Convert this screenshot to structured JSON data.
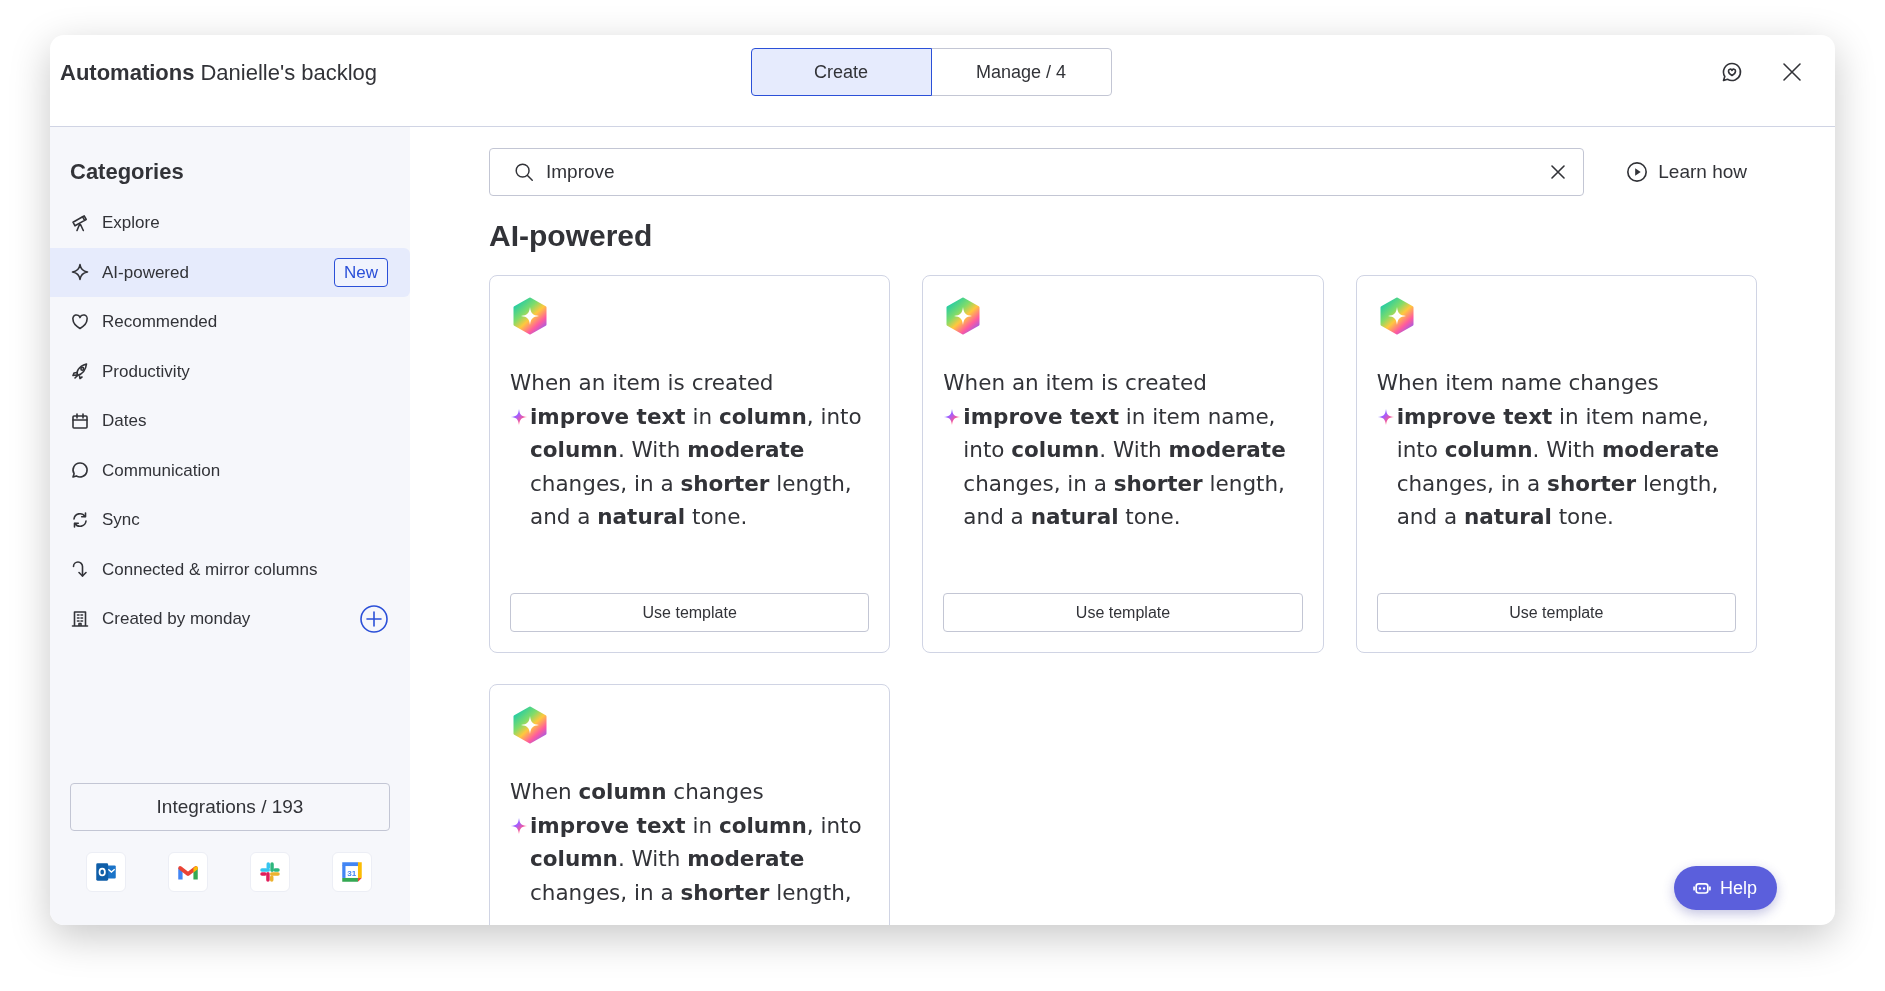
{
  "window": {
    "title": "Automations",
    "board_name": "Danielle's backlog"
  },
  "tabs": [
    {
      "label": "Create",
      "selected": true
    },
    {
      "label": "Manage / 4",
      "selected": false
    }
  ],
  "sidebar": {
    "heading": "Categories",
    "items": [
      {
        "label": "Explore",
        "kind": "category",
        "selected": false
      },
      {
        "label": "AI-powered",
        "kind": "category",
        "selected": true,
        "badge": "New"
      },
      {
        "label": "Recommended",
        "kind": "category",
        "selected": false
      },
      {
        "label": "Productivity",
        "kind": "category",
        "selected": false
      },
      {
        "label": "Dates",
        "kind": "category",
        "selected": false
      },
      {
        "label": "Communication",
        "kind": "category",
        "selected": false
      },
      {
        "label": "Sync",
        "kind": "category",
        "selected": false
      },
      {
        "label": "Connected & mirror columns",
        "kind": "category",
        "selected": false
      },
      {
        "label": "Created by monday",
        "kind": "addable",
        "selected": false
      }
    ],
    "integrations": {
      "label": "Integrations / 193",
      "calendar_day": "31"
    }
  },
  "search": {
    "value": "Improve"
  },
  "learn_how": "Learn how",
  "section": {
    "heading": "AI-powered",
    "cards": [
      {
        "trigger": "When an item is created",
        "action": "**improve text** in **column**, into **column**. With **moderate** changes, in a **shorter** length, and a **natural** tone.",
        "button": "Use template"
      },
      {
        "trigger": "When an item is created",
        "action": "**improve text** in item name, into **column**. With **moderate** changes, in a **shorter** length, and a **natural** tone.",
        "button": "Use template"
      },
      {
        "trigger": "When item name changes",
        "action": "**improve text** in item name, into **column**. With **moderate** changes, in a **shorter** length, and a **natural** tone.",
        "button": "Use template"
      },
      {
        "trigger": "When **column** changes",
        "action": "**improve text** in **column**, into **column**. With **moderate** changes, in a **shorter** length,"
      }
    ]
  },
  "help_button": "Help"
}
